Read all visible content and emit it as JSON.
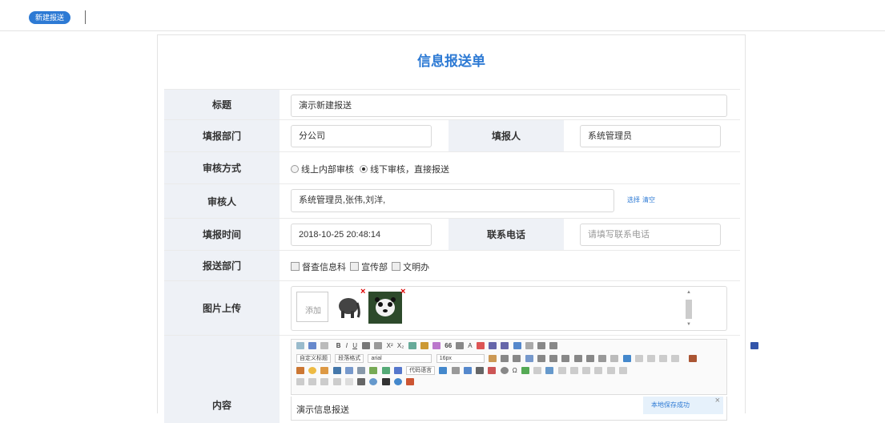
{
  "topbar": {
    "new_button": "新建报送"
  },
  "form": {
    "title": "信息报送单",
    "fields": {
      "subject": {
        "label": "标题",
        "value": "演示新建报送"
      },
      "dept": {
        "label": "填报部门",
        "value": "分公司"
      },
      "reporter": {
        "label": "填报人",
        "value": "系统管理员"
      },
      "review_mode": {
        "label": "审核方式",
        "opt1": "线上内部审核",
        "opt2": "线下审核，直接报送"
      },
      "reviewer": {
        "label": "审核人",
        "value": "系统管理员,张伟,刘洋,",
        "select": "选择",
        "clear": "清空"
      },
      "time": {
        "label": "填报时间",
        "value": "2018-10-25 20:48:14"
      },
      "phone": {
        "label": "联系电话",
        "placeholder": "请填写联系电话"
      },
      "send_dept": {
        "label": "报送部门",
        "opts": [
          "督查信息科",
          "宣传部",
          "文明办"
        ]
      },
      "images": {
        "label": "图片上传",
        "add": "添加"
      },
      "content": {
        "label": "内容",
        "value": "演示信息报送",
        "toast": "本地保存成功",
        "toolbar": {
          "custom_title": "自定义标题",
          "para": "段落格式",
          "font": "arial",
          "size": "16px",
          "code": "代码语言"
        }
      }
    }
  }
}
